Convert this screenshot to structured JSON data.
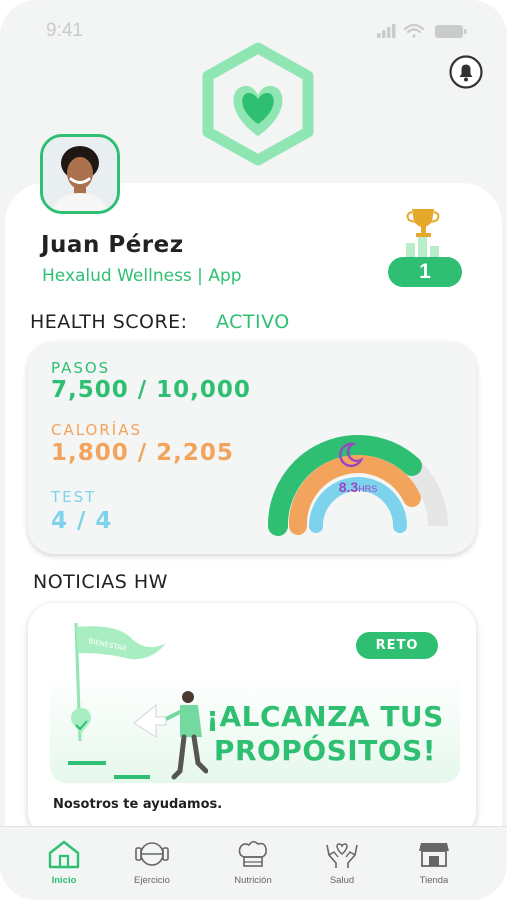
{
  "status_bar": {
    "time": "9:41"
  },
  "profile": {
    "name": "Juan Pérez",
    "subtitle": "Hexalud Wellness | App",
    "rank": "1"
  },
  "health": {
    "title": "HEALTH SCORE:",
    "status": "ACTIVO",
    "metrics": [
      {
        "label": "PASOS",
        "value": "7,500 / 10,000",
        "color": "#2fbf72"
      },
      {
        "label": "CALORÍAS",
        "value": "1,800 / 2,205",
        "color": "#f3a45c"
      },
      {
        "label": "TEST",
        "value": "4 / 4",
        "color": "#7dd3ec"
      }
    ],
    "sleep": {
      "value": "8.3",
      "unit": "HRS",
      "color": "#9a45c4"
    },
    "rings": {
      "steps_fraction": 0.75,
      "calories_fraction": 0.82,
      "test_fraction": 1.0
    }
  },
  "news": {
    "title": "NOTICIAS HW",
    "badge": "RETO",
    "flag_text": "BIENESTAR",
    "headline_line1": "¡ALCANZA TUS",
    "headline_line2": "PROPÓSITOS!",
    "subtitle": "Nosotros te ayudamos."
  },
  "nav": {
    "items": [
      {
        "label": "Inicio",
        "icon": "home-icon",
        "active": true
      },
      {
        "label": "Ejercicio",
        "icon": "dumbbell-icon",
        "active": false
      },
      {
        "label": "Nutrición",
        "icon": "chef-hat-icon",
        "active": false
      },
      {
        "label": "Salud",
        "icon": "hands-heart-icon",
        "active": false
      },
      {
        "label": "Tienda",
        "icon": "store-icon",
        "active": false
      }
    ]
  },
  "colors": {
    "brand": "#2fbf72",
    "calories": "#f3a45c",
    "test": "#7dd3ec",
    "sleep": "#9a45c4"
  }
}
